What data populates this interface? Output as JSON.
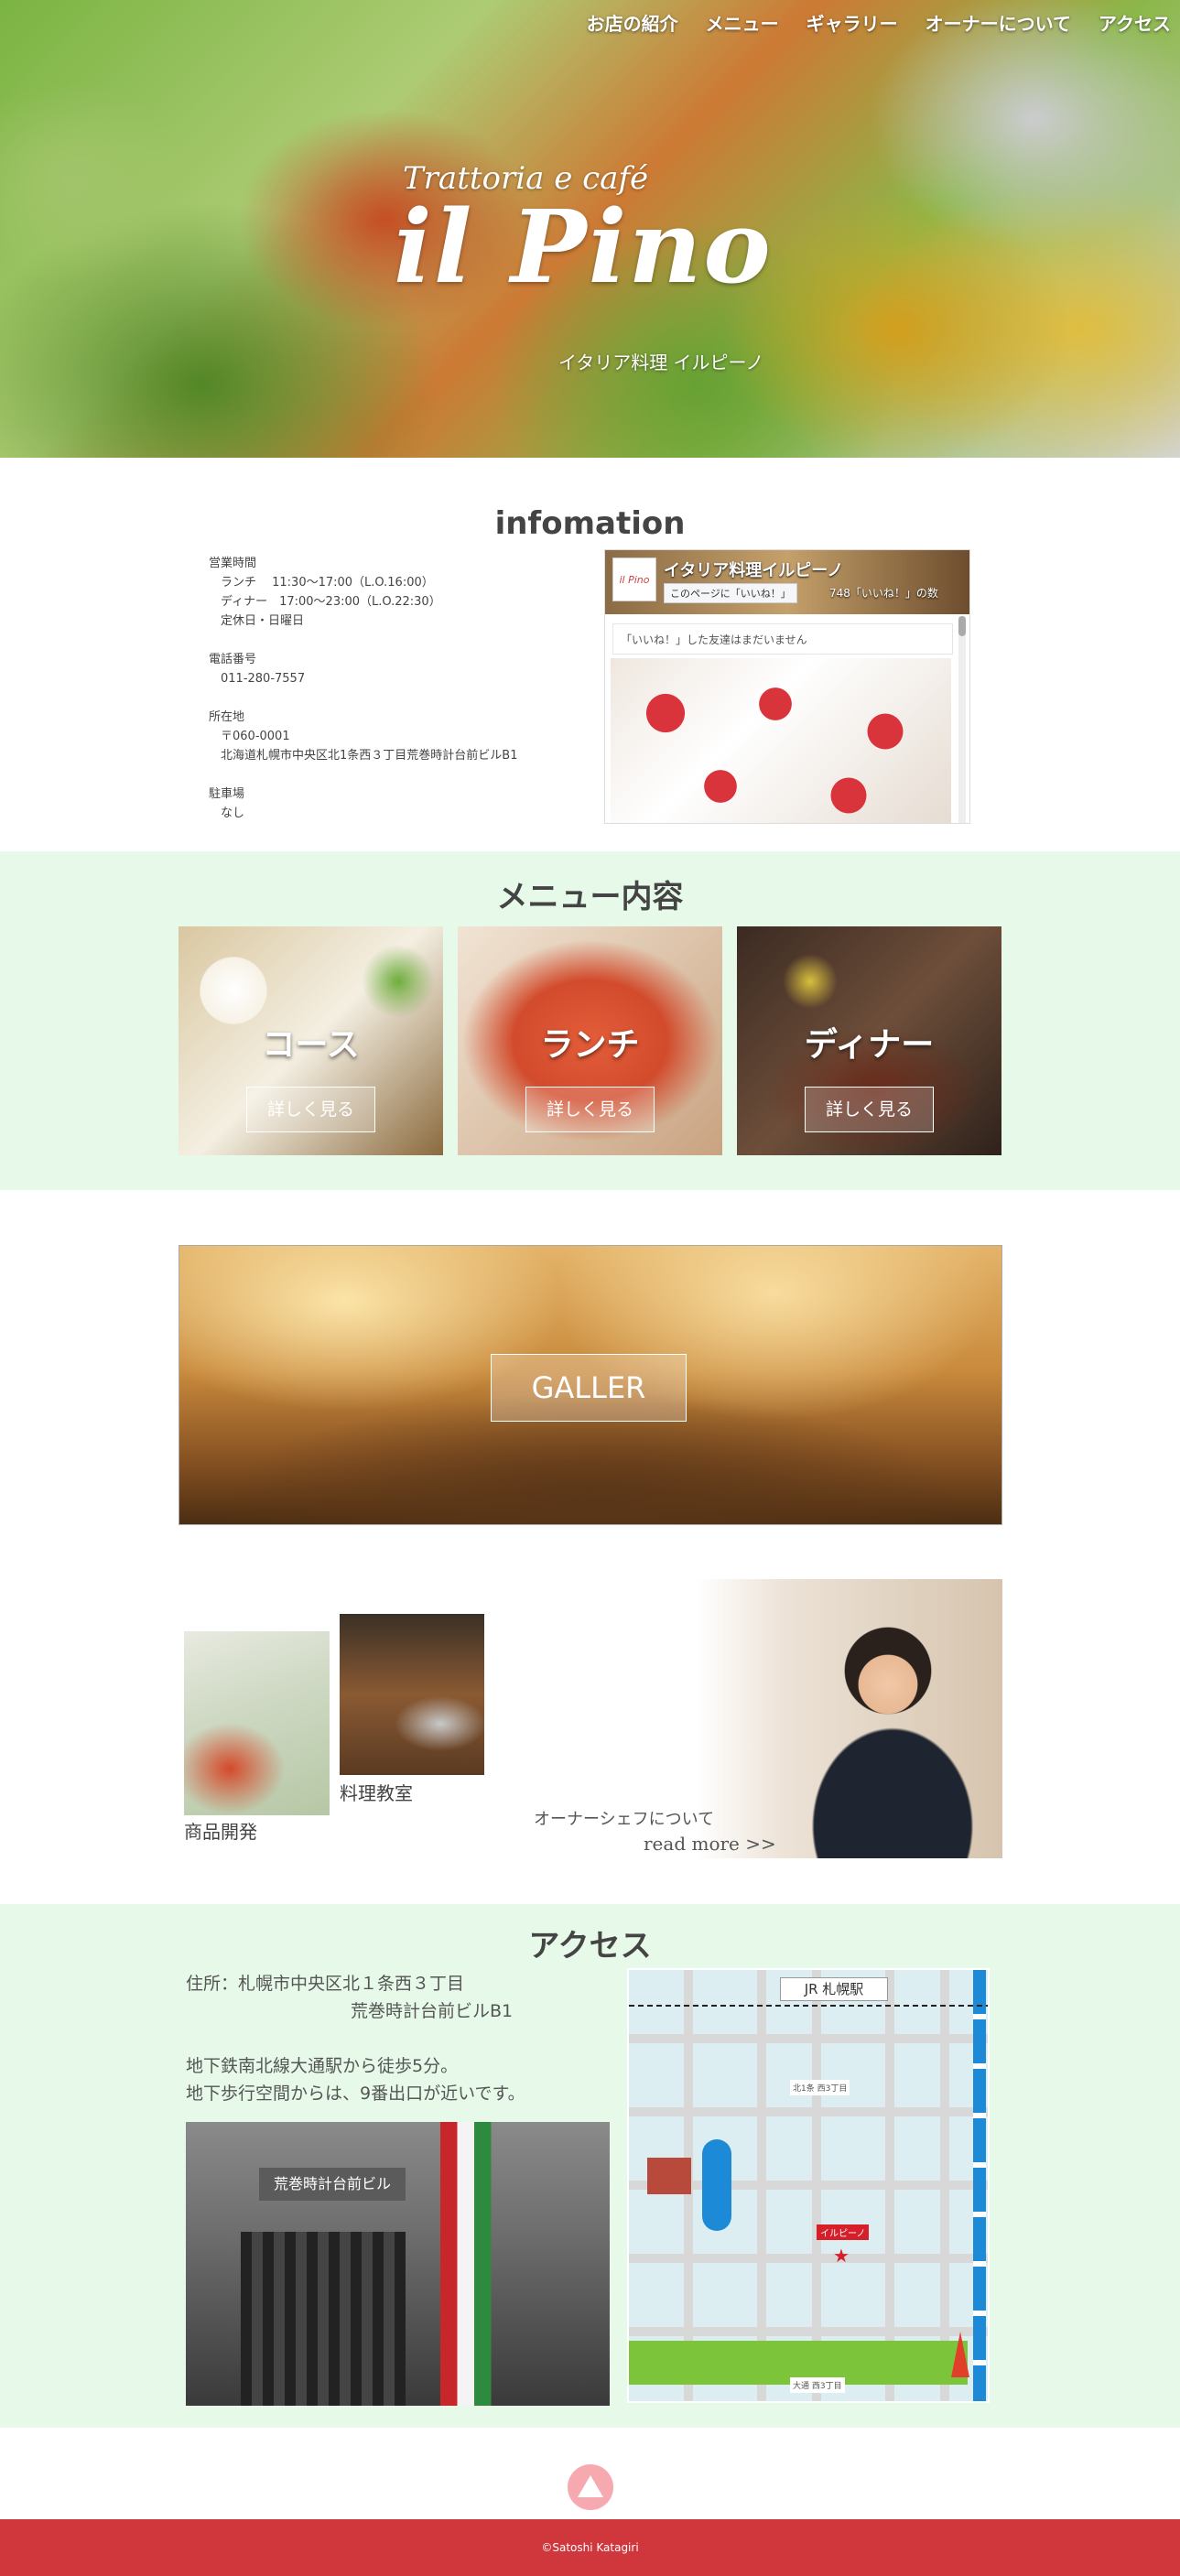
{
  "nav": [
    "お店の紹介",
    "メニュー",
    "ギャラリー",
    "オーナーについて",
    "アクセス"
  ],
  "logo": {
    "sub": "Trattoria e café",
    "main": "il Pino",
    "jp": "イタリア料理 イルピーノ"
  },
  "info": {
    "title": "infomation",
    "text": "営業時間\n　ランチ　 11:30～17:00（L.O.16:00）\n　ディナー　17:00～23:00（L.O.22:30）\n　定休日・日曜日\n\n電話番号\n　011-280-7557\n\n所在地\n　〒060-0001\n　北海道札幌市中央区北1条西３丁目荒巻時計台前ビルB1\n\n駐車場\n　なし",
    "fb": {
      "logo": "il Pino",
      "name": "イタリア料理イルピーノ",
      "like": "このページに「いいね！」",
      "count": "748「いいね！」の数",
      "friends": "「いいね！」した友達はまだいません"
    }
  },
  "menu": {
    "title": "メニュー内容",
    "cards": [
      {
        "label": "コース",
        "btn": "詳しく見る"
      },
      {
        "label": "ランチ",
        "btn": "詳しく見る"
      },
      {
        "label": "ディナー",
        "btn": "詳しく見る"
      }
    ]
  },
  "gallery": {
    "btn": "GALLER"
  },
  "owner": {
    "cap1": "商品開発",
    "cap2": "料理教室",
    "line1": "オーナーシェフについて",
    "line2": "read more >>"
  },
  "access": {
    "title": "アクセス",
    "line1": "住所：札幌市中央区北１条西３丁目",
    "line2": "荒巻時計台前ビルB1",
    "line3": "地下鉄南北線大通駅から徒歩5分。",
    "line4": "地下歩行空間からは、9番出口が近いです。",
    "sign": "荒巻時計台前ビル",
    "map": {
      "station": "JR 札幌駅",
      "pin": "イルピーノ",
      "lbl1": "北1条 西3丁目",
      "lbl2": "大通 西3丁目"
    }
  },
  "footer": "©Satoshi Katagiri"
}
